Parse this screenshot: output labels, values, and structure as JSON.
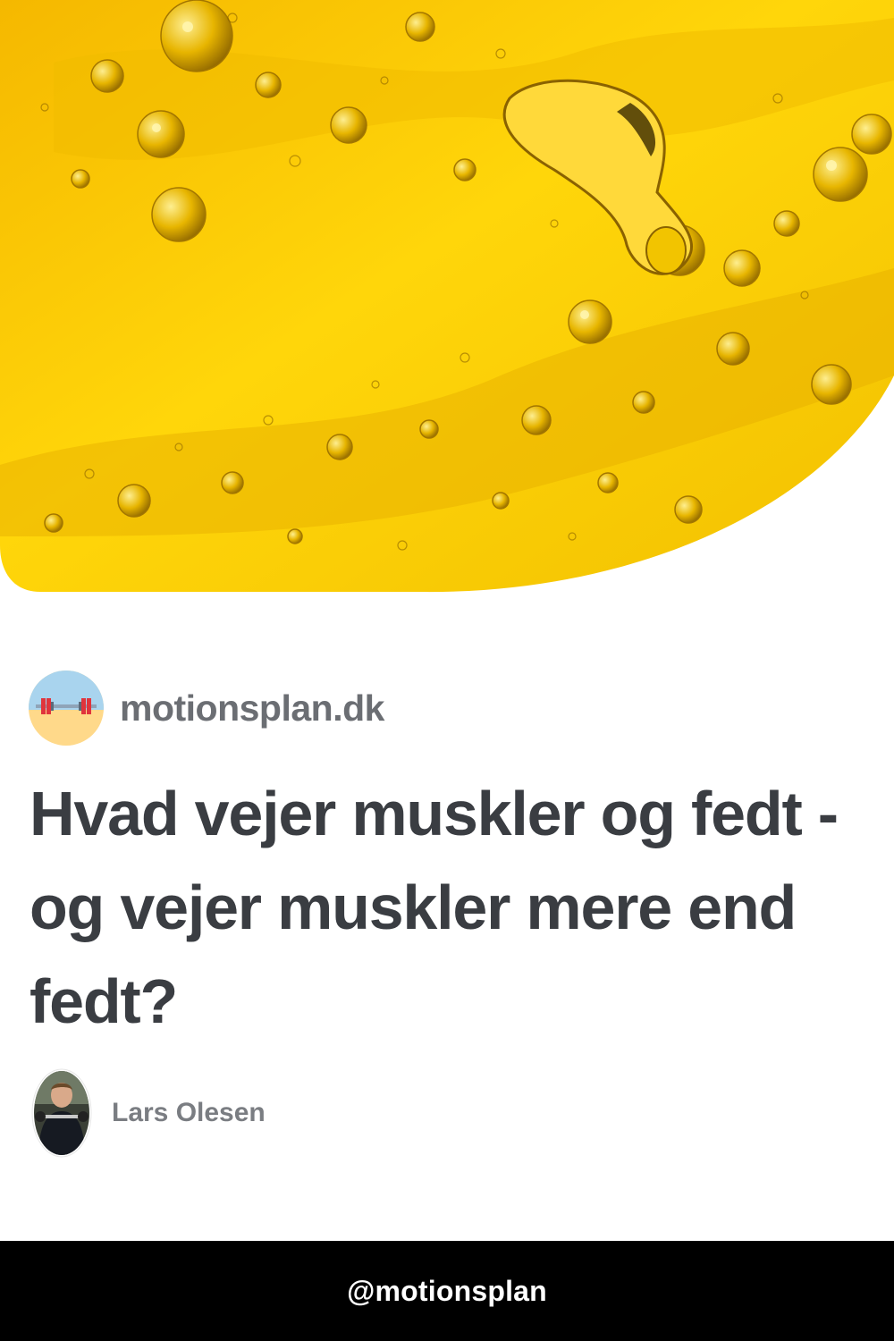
{
  "site": {
    "name": "motionsplan.dk",
    "logo_icon": "barbell-icon"
  },
  "article": {
    "title": "Hvad vejer muskler og fedt - og vejer muskler mere end fedt?"
  },
  "author": {
    "name": "Lars Olesen"
  },
  "footer": {
    "handle": "@motionsplan"
  },
  "colors": {
    "hero_yellow": "#f7c800",
    "site_name": "#6b6e73",
    "title": "#3a3d42",
    "author": "#7a7d82",
    "footer_bg": "#000000",
    "footer_text": "#ffffff"
  }
}
